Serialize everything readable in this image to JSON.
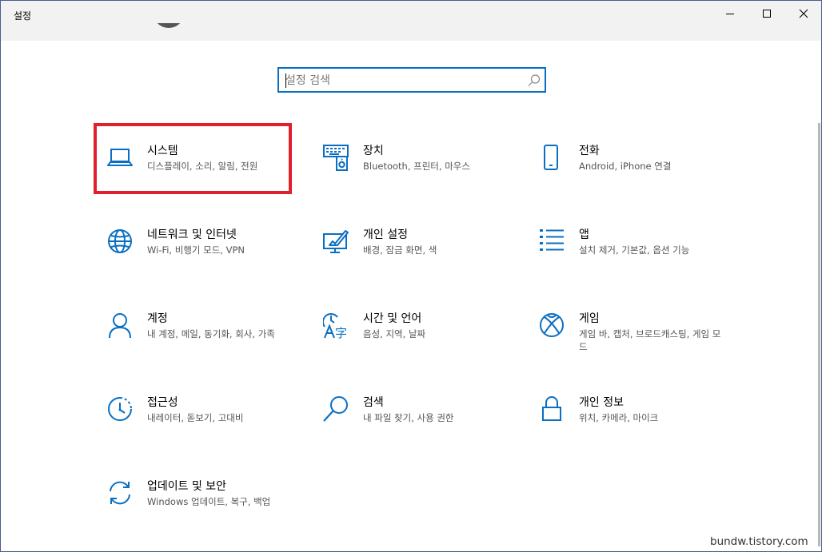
{
  "window": {
    "title": "설정",
    "controls": {
      "minimize": "minimize-icon",
      "maximize": "maximize-icon",
      "close": "close-icon"
    }
  },
  "search": {
    "placeholder": "설정 검색",
    "value": "",
    "icon": "search-icon"
  },
  "colors": {
    "accent": "#0a6fc2",
    "highlight_border": "#e0202a",
    "title_bar": "#f2f2f2"
  },
  "categories": [
    {
      "title": "시스템",
      "desc": "디스플레이, 소리, 알림, 전원",
      "icon": "laptop-icon"
    },
    {
      "title": "장치",
      "desc": "Bluetooth, 프린터, 마우스",
      "icon": "keyboard-speaker-icon"
    },
    {
      "title": "전화",
      "desc": "Android, iPhone 연결",
      "icon": "phone-icon"
    },
    {
      "title": "네트워크 및 인터넷",
      "desc": "Wi-Fi, 비행기 모드, VPN",
      "icon": "globe-icon"
    },
    {
      "title": "개인 설정",
      "desc": "배경, 잠금 화면, 색",
      "icon": "personalization-icon"
    },
    {
      "title": "앱",
      "desc": "설치 제거, 기본값, 옵션 기능",
      "icon": "apps-list-icon"
    },
    {
      "title": "계정",
      "desc": "내 계정, 메일, 동기화, 회사, 가족",
      "icon": "person-icon"
    },
    {
      "title": "시간 및 언어",
      "desc": "음성, 지역, 날짜",
      "icon": "time-language-icon"
    },
    {
      "title": "게임",
      "desc": "게임 바, 캡처, 브로드캐스팅, 게임 모드",
      "icon": "xbox-icon"
    },
    {
      "title": "접근성",
      "desc": "내레이터, 돋보기, 고대비",
      "icon": "ease-of-access-icon"
    },
    {
      "title": "검색",
      "desc": "내 파일 찾기, 사용 권한",
      "icon": "magnifier-icon"
    },
    {
      "title": "개인 정보",
      "desc": "위치, 카메라, 마이크",
      "icon": "lock-icon"
    },
    {
      "title": "업데이트 및 보안",
      "desc": "Windows 업데이트, 복구, 백업",
      "icon": "sync-icon"
    }
  ],
  "watermark": "bundw.tistory.com"
}
